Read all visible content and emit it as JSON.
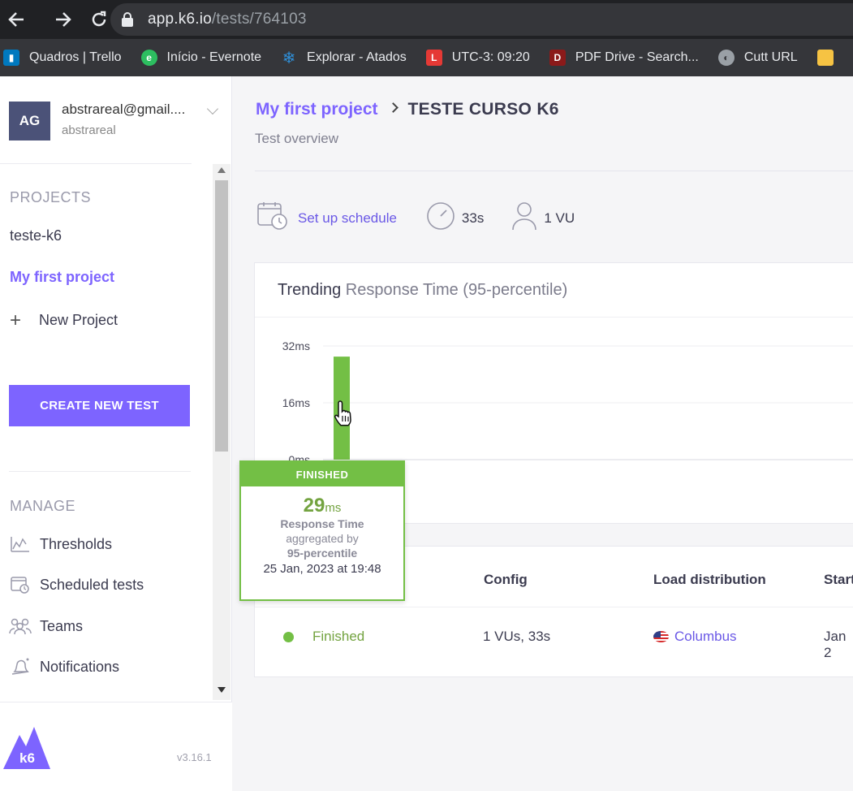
{
  "browser": {
    "url_host": "app.k6.io",
    "url_path": "/tests/764103",
    "bookmarks": [
      {
        "label": "Quadros | Trello",
        "icon": "trello-icon",
        "color": "#0079bf"
      },
      {
        "label": "Início - Evernote",
        "icon": "evernote-icon",
        "color": "#2dbe60"
      },
      {
        "label": "Explorar - Atados",
        "icon": "snowflake-icon",
        "color": "#2f8fd8"
      },
      {
        "label": "UTC-3: 09:20",
        "icon": "l-icon",
        "color": "#e53935"
      },
      {
        "label": "PDF Drive - Search...",
        "icon": "pdfdrive-icon",
        "color": "#b71c1c"
      },
      {
        "label": "Cutt URL",
        "icon": "globe-icon",
        "color": "#9aa0a6"
      }
    ]
  },
  "account": {
    "initials": "AG",
    "email": "abstrareal@gmail....",
    "username": "abstrareal"
  },
  "sidebar": {
    "projects_heading": "PROJECTS",
    "projects": [
      "teste-k6",
      "My first project"
    ],
    "new_project": "New Project",
    "create_button": "CREATE NEW TEST",
    "manage_heading": "MANAGE",
    "manage_items": [
      {
        "label": "Thresholds",
        "icon": "thresholds-icon"
      },
      {
        "label": "Scheduled tests",
        "icon": "scheduled-tests-icon"
      },
      {
        "label": "Teams",
        "icon": "teams-icon"
      },
      {
        "label": "Notifications",
        "icon": "bell-icon"
      }
    ],
    "logo_text": "k6",
    "version": "v3.16.1"
  },
  "main": {
    "project_name": "My first project",
    "test_name": "TESTE CURSO K6",
    "subtitle": "Test overview",
    "schedule_link": "Set up schedule",
    "duration": "33s",
    "vus": "1 VU"
  },
  "chart": {
    "title_bold": "Trending",
    "title_rest": "Response Time (95-percentile)"
  },
  "chart_data": {
    "type": "bar",
    "categories": [
      "25 Jan, 2023 at 19:48"
    ],
    "values": [
      29
    ],
    "ylim": [
      0,
      32
    ],
    "yticks": [
      0,
      16,
      32
    ],
    "ytick_labels": [
      "0ms",
      "16ms",
      "32ms"
    ],
    "bar_color": "#73bf45"
  },
  "tooltip": {
    "status": "FINISHED",
    "value": "29",
    "unit": "ms",
    "metric": "Response Time",
    "agg_label": "aggregated by",
    "agg_value": "95-percentile",
    "date": "25 Jan, 2023 at 19:48"
  },
  "table": {
    "headers": [
      "Config",
      "Load distribution",
      "Start"
    ],
    "row": {
      "status": "Finished",
      "config": "1 VUs, 33s",
      "location": "Columbus",
      "start": "Jan 2"
    }
  }
}
